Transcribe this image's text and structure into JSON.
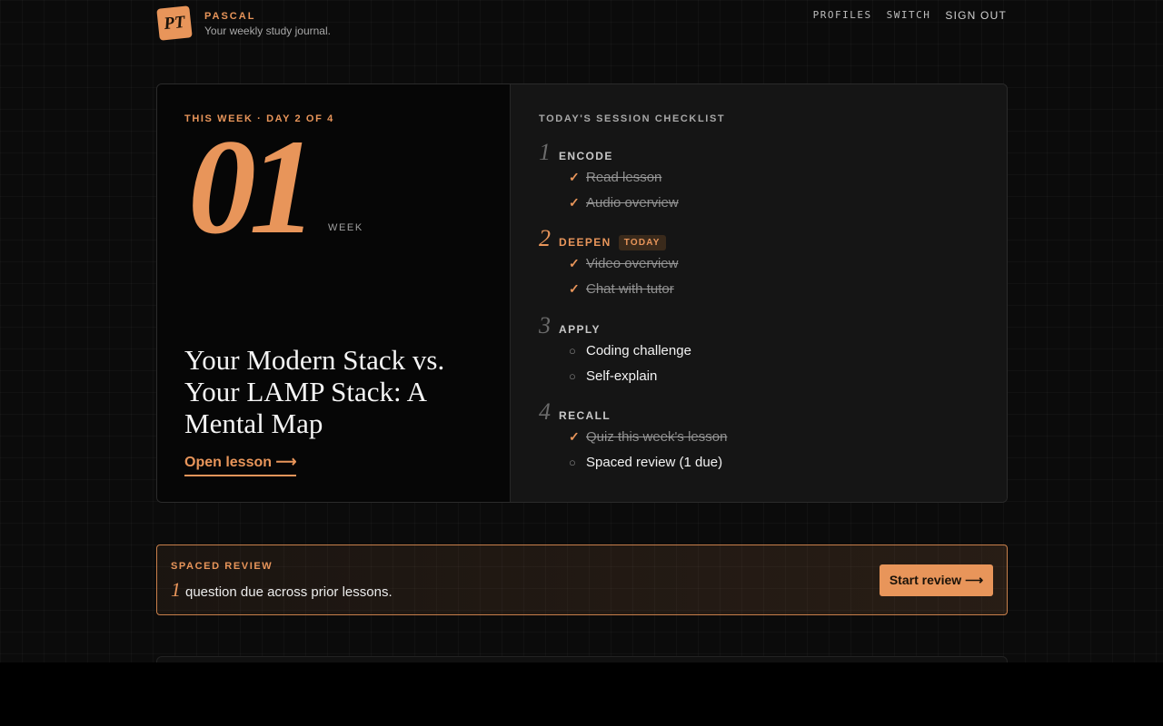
{
  "header": {
    "logo_text": "PT",
    "brand_name": "PASCAL",
    "tagline": "Your weekly study journal.",
    "nav": [
      "PROFILES",
      "SWITCH",
      "SIGN OUT"
    ]
  },
  "week": {
    "eyebrow": "THIS WEEK · DAY 2 OF 4",
    "number": "01",
    "label": "WEEK",
    "lesson_title": "Your Modern Stack vs. Your LAMP Stack: A Mental Map",
    "open_lesson": "Open lesson ⟶"
  },
  "checklist": {
    "title": "TODAY'S SESSION CHECKLIST",
    "steps": [
      {
        "num": "1",
        "name": "ENCODE",
        "badge": "",
        "items": [
          {
            "text": "Read lesson",
            "done": true
          },
          {
            "text": "Audio overview",
            "done": true
          }
        ]
      },
      {
        "num": "2",
        "name": "DEEPEN",
        "badge": "TODAY",
        "items": [
          {
            "text": "Video overview",
            "done": true
          },
          {
            "text": "Chat with tutor",
            "done": true
          }
        ]
      },
      {
        "num": "3",
        "name": "APPLY",
        "badge": "",
        "items": [
          {
            "text": "Coding challenge",
            "done": false
          },
          {
            "text": "Self-explain",
            "done": false
          }
        ]
      },
      {
        "num": "4",
        "name": "RECALL",
        "badge": "",
        "items": [
          {
            "text": "Quiz this week's lesson",
            "done": true
          },
          {
            "text": "Spaced review (1 due)",
            "done": false
          }
        ]
      }
    ],
    "marks": {
      "done": "✓",
      "todo": "○"
    }
  },
  "review": {
    "eyebrow": "SPACED REVIEW",
    "count": "1",
    "text": "question due across prior lessons.",
    "button": "Start review ⟶"
  },
  "colors": {
    "accent": "#e8955a",
    "background": "#0b0b0b",
    "panel": "#151515"
  }
}
